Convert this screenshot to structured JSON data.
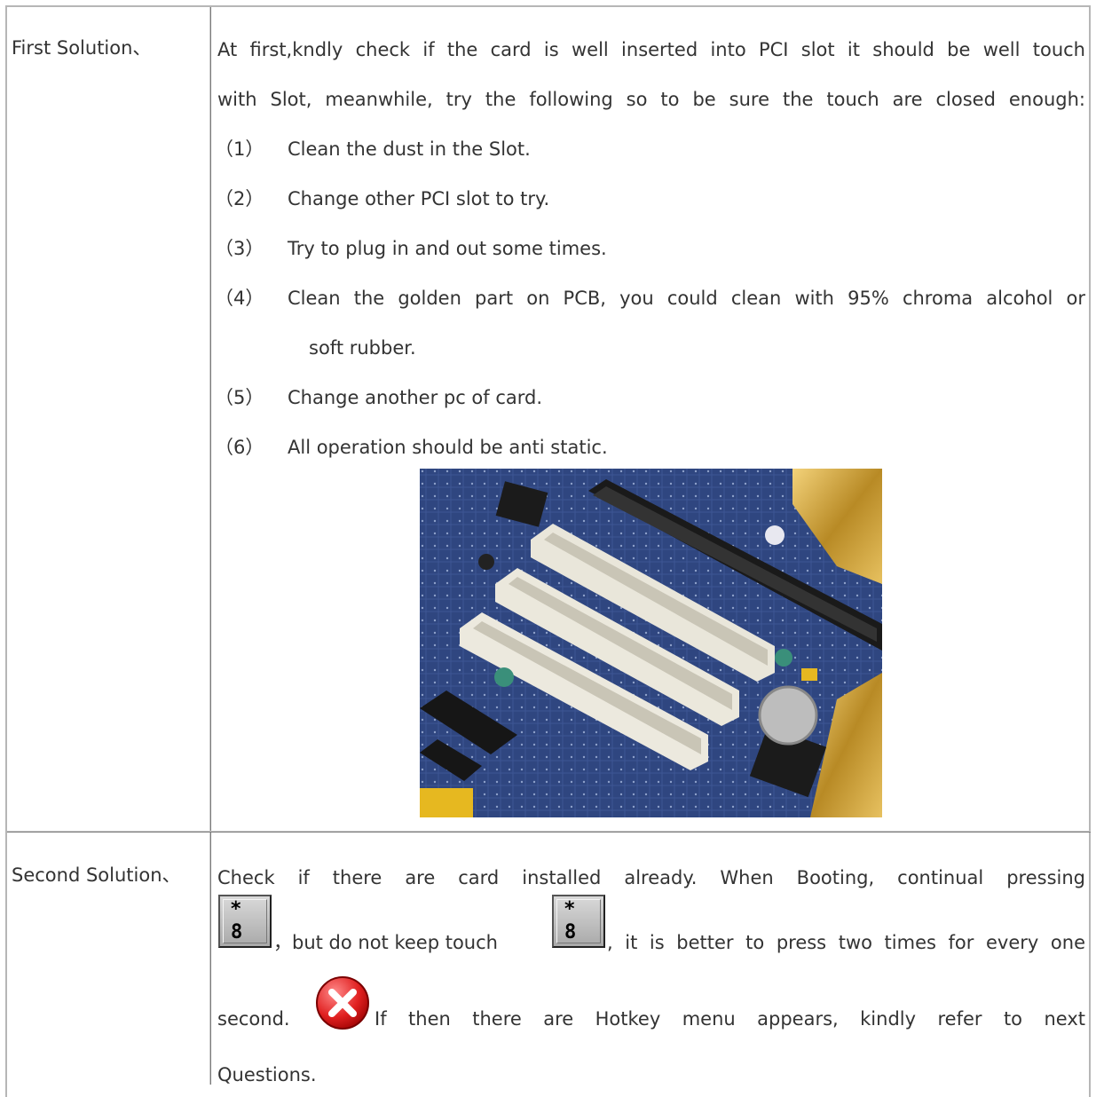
{
  "row1": {
    "label": "First Solution、",
    "intro_line1": "At first,kndly check if the card is well inserted into PCI slot it should be well touch",
    "intro_line2": "with Slot, meanwhile, try the following so to be sure the touch are closed enough:",
    "steps": [
      {
        "num": "（1）",
        "text": "Clean the dust in the Slot."
      },
      {
        "num": "（2）",
        "text": "Change other PCI slot to try."
      },
      {
        "num": "（3）",
        "text": "Try to plug in and out some times."
      },
      {
        "num": "（4）",
        "text": "Clean the golden part on PCB, you could clean with 95% chroma   alcohol or",
        "cont": "soft rubber."
      },
      {
        "num": "（5）",
        "text": "Change another pc of card."
      },
      {
        "num": "（6）",
        "text": "All operation should be anti static."
      }
    ],
    "image_name": "pci-slots-photo"
  },
  "row2": {
    "label": "Second Solution、",
    "line1": "Check if there are card installed already. When Booting, continual   pressing",
    "line2_a": "，but do not keep touch",
    "line2_b": ", it is better to press two times for every one",
    "line3_a": "second.",
    "line3_b": "If then there are Hotkey menu appears, kindly refer to next",
    "line4": "Questions.",
    "key": {
      "top": "*",
      "bottom": "8"
    }
  },
  "colors": {
    "border_light": "#c8c8c8",
    "border_dark": "#7a7a7a",
    "text": "#333333",
    "error_red": "#e02020"
  }
}
